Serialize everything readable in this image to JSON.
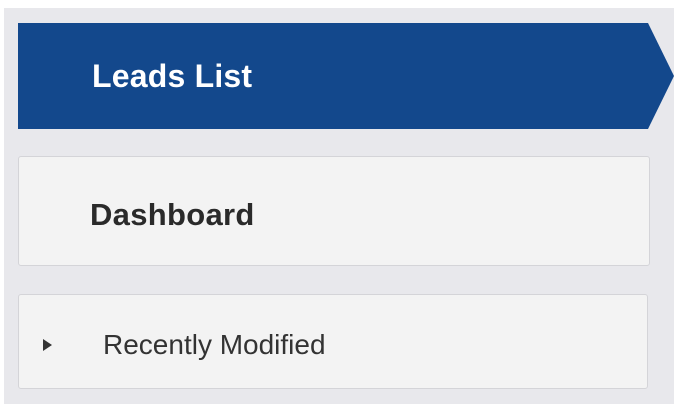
{
  "nav": {
    "active_item": {
      "label": "Leads List",
      "color": "#13488c"
    },
    "items": [
      {
        "label": "Dashboard"
      }
    ],
    "recent": {
      "label": "Recently Modified",
      "icon": "caret-right-icon",
      "expanded": false
    }
  }
}
